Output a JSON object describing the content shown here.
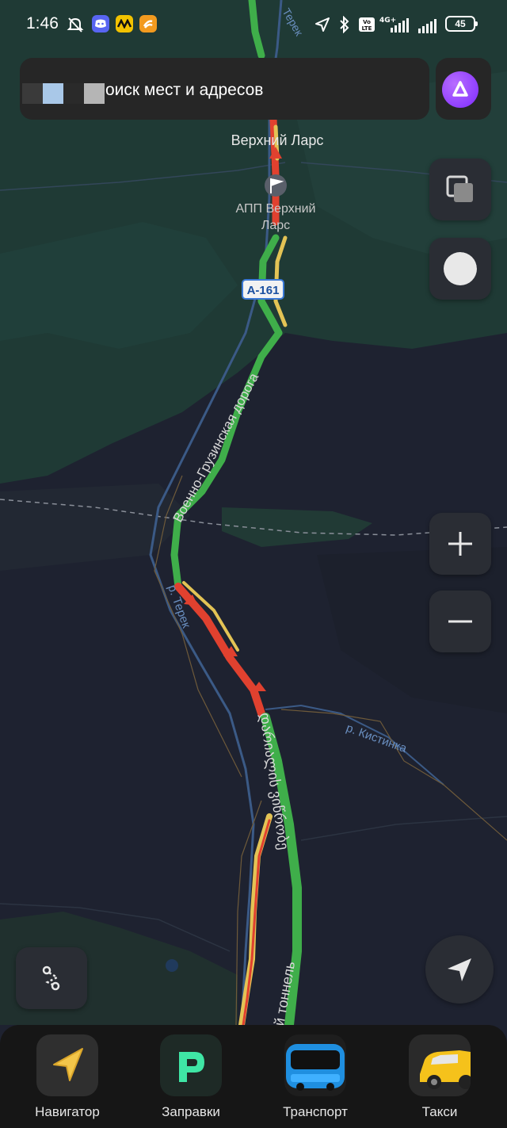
{
  "status_bar": {
    "time": "1:46",
    "network_label": "4G+",
    "volte_label": "Vo LTE",
    "battery": "45",
    "icons": [
      "mute-icon",
      "discord-icon",
      "app-icon-yellow",
      "app-icon-orange",
      "location-arrow-icon",
      "bluetooth-icon",
      "volte-icon",
      "signal-icon",
      "wifi-icon",
      "battery-icon"
    ]
  },
  "search": {
    "placeholder": "оиск мест и адресов"
  },
  "map": {
    "place_label": "Верхний Ларс",
    "checkpoint_label_line1": "АПП Верхний",
    "checkpoint_label_line2": "Ларс",
    "road_shield": "А-161",
    "road_name": "Военно-Грузинская дорога",
    "river_terek_top": "Терек",
    "river_terek": "р. Терек",
    "river_kistinka": "р. Кистинка",
    "georgian_road": "დარიალის ვიწრობე",
    "tunnel_label": "й тоннель"
  },
  "controls": {
    "layers": "layers-icon",
    "theme": "night-mode-icon",
    "zoom_in": "+",
    "zoom_out": "−",
    "route": "route-icon",
    "locate": "locate-arrow-icon"
  },
  "dock": [
    {
      "label": "Навигатор",
      "icon": "navigator-icon"
    },
    {
      "label": "Заправки",
      "icon": "fuel-icon"
    },
    {
      "label": "Транспорт",
      "icon": "bus-icon"
    },
    {
      "label": "Такси",
      "icon": "taxi-icon"
    }
  ],
  "colors": {
    "map_background": "#1e2230",
    "forest": "#1f3a35",
    "traffic_green": "#3fae4a",
    "traffic_yellow": "#e3c355",
    "traffic_red": "#e0412f",
    "alice": "#8a3cff"
  }
}
